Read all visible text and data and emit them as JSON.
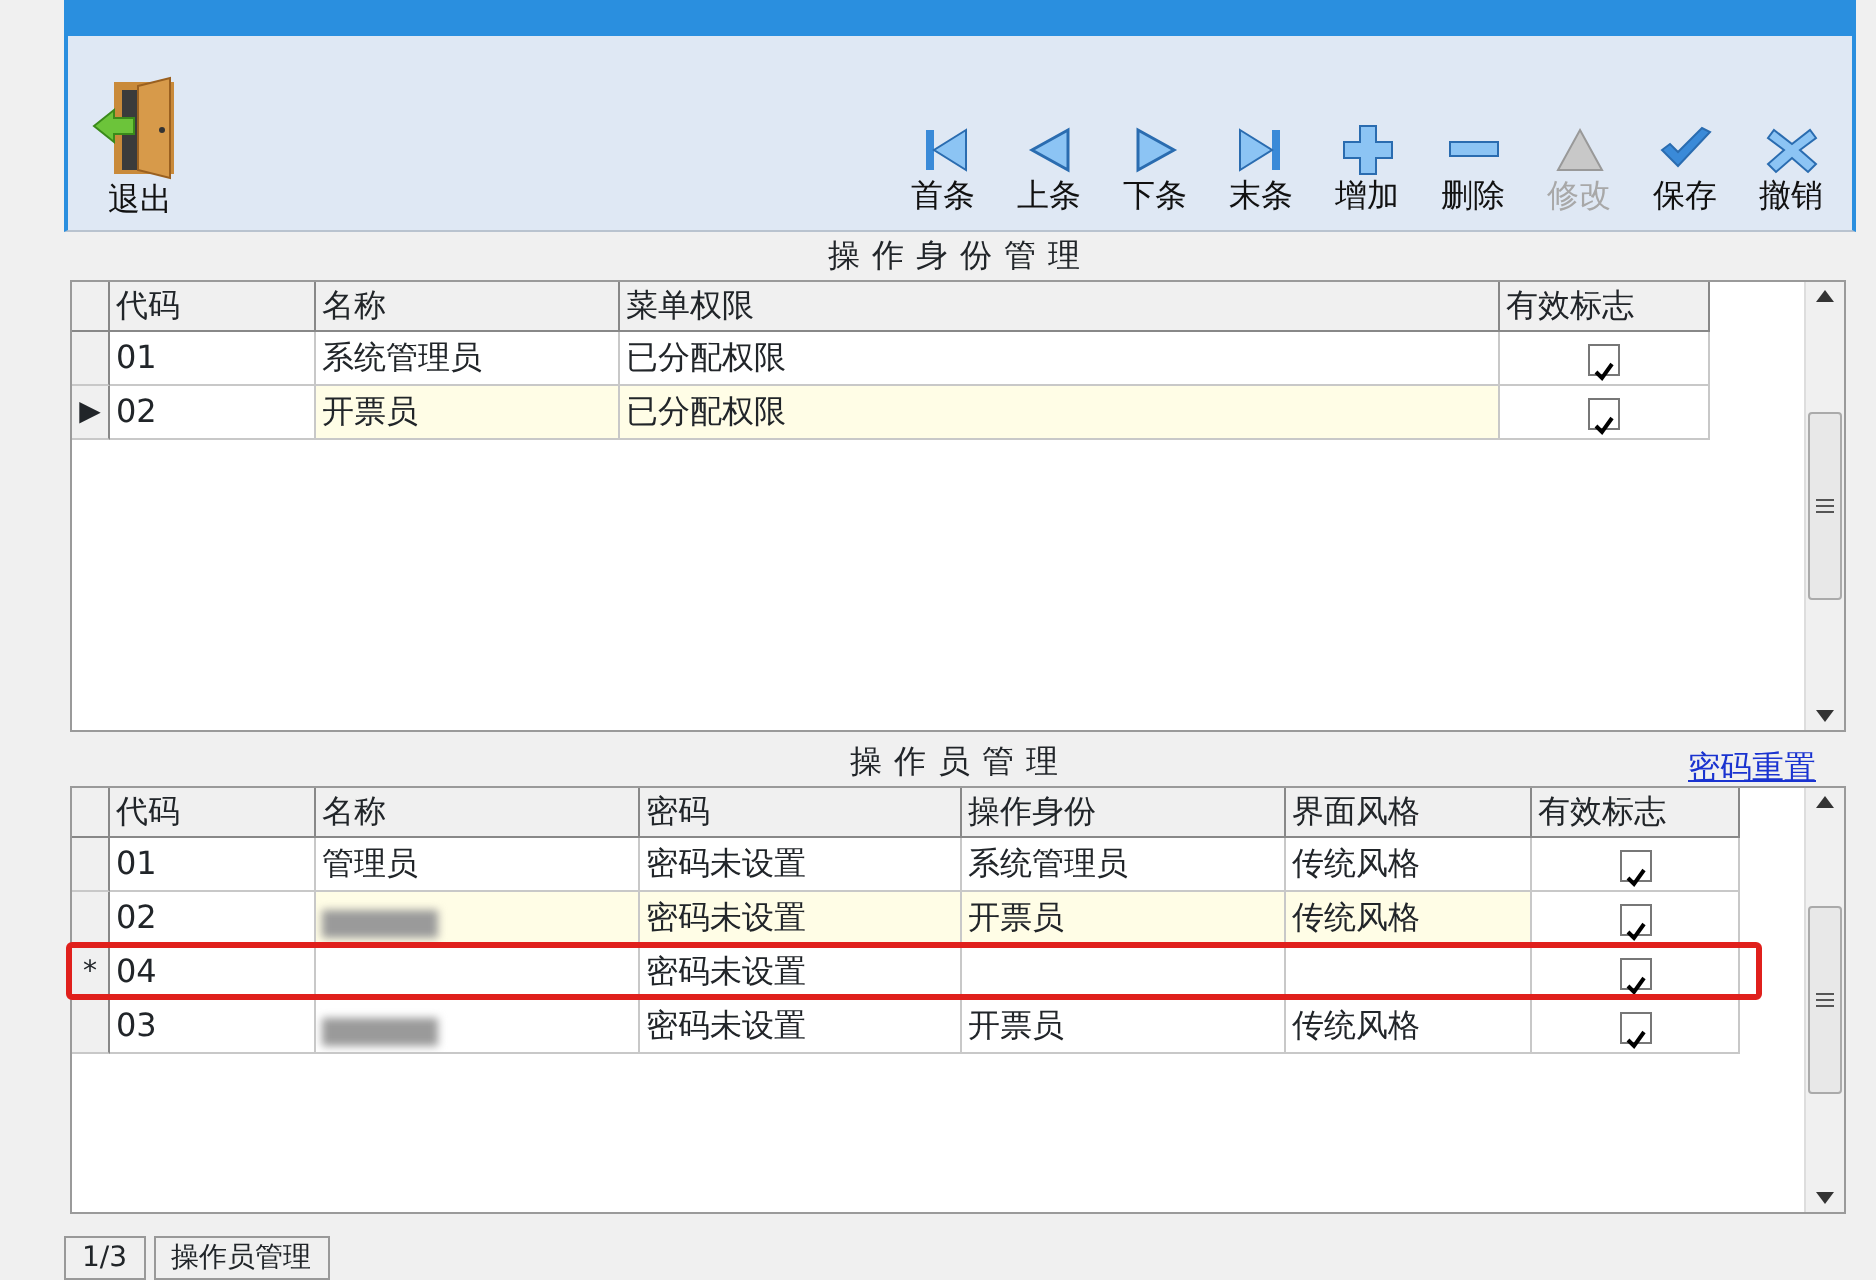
{
  "toolbar": {
    "exit": {
      "label": "退出"
    },
    "buttons": [
      {
        "kind": "first",
        "label": "首条",
        "disabled": false
      },
      {
        "kind": "prev",
        "label": "上条",
        "disabled": false
      },
      {
        "kind": "next",
        "label": "下条",
        "disabled": false
      },
      {
        "kind": "last",
        "label": "末条",
        "disabled": false
      },
      {
        "kind": "add",
        "label": "增加",
        "disabled": false
      },
      {
        "kind": "delete",
        "label": "删除",
        "disabled": false
      },
      {
        "kind": "edit",
        "label": "修改",
        "disabled": true
      },
      {
        "kind": "save",
        "label": "保存",
        "disabled": false
      },
      {
        "kind": "cancel",
        "label": "撤销",
        "disabled": false
      }
    ]
  },
  "role_panel": {
    "title": "操作身份管理",
    "table": {
      "columns": [
        "代码",
        "名称",
        "菜单权限",
        "有效标志"
      ],
      "rows": [
        {
          "selected": false,
          "cells": [
            "01",
            "系统管理员",
            "已分配权限"
          ],
          "checked": true
        },
        {
          "marker": "▶",
          "selected": true,
          "cells": [
            "02",
            "开票员",
            "已分配权限"
          ],
          "checked": true
        }
      ]
    }
  },
  "operator_panel": {
    "title": "操作员管理",
    "link": "密码重置",
    "table": {
      "columns": [
        "代码",
        "名称",
        "密码",
        "操作身份",
        "界面风格",
        "有效标志"
      ],
      "rows": [
        {
          "selected": false,
          "cells": [
            "01",
            "管理员",
            "密码未设置",
            "系统管理员",
            "传统风格"
          ],
          "checked": true
        },
        {
          "selected": true,
          "cells": [
            "02",
            {
              "blurred": true
            },
            "密码未设置",
            "开票员",
            "传统风格"
          ],
          "checked": true
        },
        {
          "marker": "*",
          "selected": false,
          "highlighted": true,
          "cells": [
            "04",
            "",
            "密码未设置",
            "",
            ""
          ],
          "checked": true
        },
        {
          "selected": false,
          "cells": [
            "03",
            {
              "blurred": true
            },
            "密码未设置",
            "开票员",
            "传统风格"
          ],
          "checked": true
        }
      ]
    }
  },
  "status_bar": [
    "1/3",
    "操作员管理"
  ]
}
